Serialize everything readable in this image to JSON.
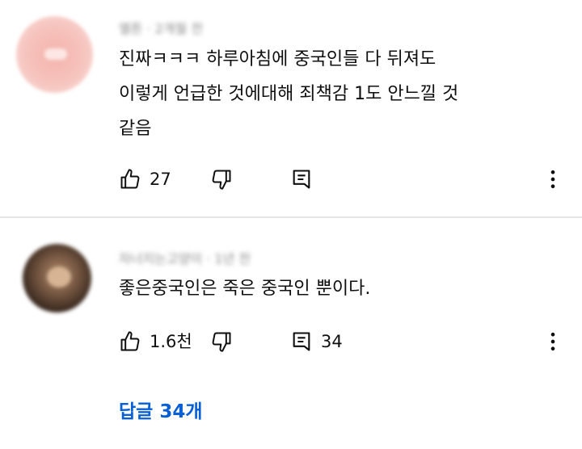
{
  "comments": [
    {
      "author": "엘튼 · 2개월 전",
      "lines": [
        "진짜ㅋㅋㅋ 하루아침에 중국인들 다 뒤져도",
        "이렇게 언급한 것에대해 죄책감 1도 안느낄 것",
        "같음"
      ],
      "likes": "27",
      "replies": ""
    },
    {
      "author": "자너지는고양이 · 1년 전",
      "lines": [
        "좋은중국인은 죽은 중국인 뿐이다."
      ],
      "likes": "1.6천",
      "replies": "34"
    }
  ],
  "replies_link": {
    "label": "답글 34개"
  },
  "icons": [
    "thumbs-up",
    "thumbs-down",
    "reply",
    "more-vertical"
  ],
  "colors": {
    "link": "#065fd4",
    "text": "#0f0f0f",
    "meta": "#8a8a8a",
    "divider": "#e5e5e5"
  }
}
